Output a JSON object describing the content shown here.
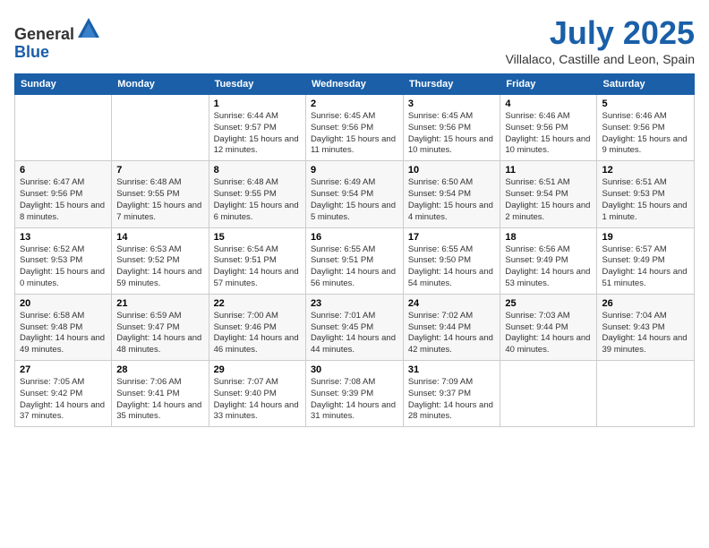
{
  "header": {
    "logo_general": "General",
    "logo_blue": "Blue",
    "month": "July 2025",
    "location": "Villalaco, Castille and Leon, Spain"
  },
  "weekdays": [
    "Sunday",
    "Monday",
    "Tuesday",
    "Wednesday",
    "Thursday",
    "Friday",
    "Saturday"
  ],
  "weeks": [
    [
      {
        "day": "",
        "info": ""
      },
      {
        "day": "",
        "info": ""
      },
      {
        "day": "1",
        "info": "Sunrise: 6:44 AM\nSunset: 9:57 PM\nDaylight: 15 hours and 12 minutes."
      },
      {
        "day": "2",
        "info": "Sunrise: 6:45 AM\nSunset: 9:56 PM\nDaylight: 15 hours and 11 minutes."
      },
      {
        "day": "3",
        "info": "Sunrise: 6:45 AM\nSunset: 9:56 PM\nDaylight: 15 hours and 10 minutes."
      },
      {
        "day": "4",
        "info": "Sunrise: 6:46 AM\nSunset: 9:56 PM\nDaylight: 15 hours and 10 minutes."
      },
      {
        "day": "5",
        "info": "Sunrise: 6:46 AM\nSunset: 9:56 PM\nDaylight: 15 hours and 9 minutes."
      }
    ],
    [
      {
        "day": "6",
        "info": "Sunrise: 6:47 AM\nSunset: 9:56 PM\nDaylight: 15 hours and 8 minutes."
      },
      {
        "day": "7",
        "info": "Sunrise: 6:48 AM\nSunset: 9:55 PM\nDaylight: 15 hours and 7 minutes."
      },
      {
        "day": "8",
        "info": "Sunrise: 6:48 AM\nSunset: 9:55 PM\nDaylight: 15 hours and 6 minutes."
      },
      {
        "day": "9",
        "info": "Sunrise: 6:49 AM\nSunset: 9:54 PM\nDaylight: 15 hours and 5 minutes."
      },
      {
        "day": "10",
        "info": "Sunrise: 6:50 AM\nSunset: 9:54 PM\nDaylight: 15 hours and 4 minutes."
      },
      {
        "day": "11",
        "info": "Sunrise: 6:51 AM\nSunset: 9:54 PM\nDaylight: 15 hours and 2 minutes."
      },
      {
        "day": "12",
        "info": "Sunrise: 6:51 AM\nSunset: 9:53 PM\nDaylight: 15 hours and 1 minute."
      }
    ],
    [
      {
        "day": "13",
        "info": "Sunrise: 6:52 AM\nSunset: 9:53 PM\nDaylight: 15 hours and 0 minutes."
      },
      {
        "day": "14",
        "info": "Sunrise: 6:53 AM\nSunset: 9:52 PM\nDaylight: 14 hours and 59 minutes."
      },
      {
        "day": "15",
        "info": "Sunrise: 6:54 AM\nSunset: 9:51 PM\nDaylight: 14 hours and 57 minutes."
      },
      {
        "day": "16",
        "info": "Sunrise: 6:55 AM\nSunset: 9:51 PM\nDaylight: 14 hours and 56 minutes."
      },
      {
        "day": "17",
        "info": "Sunrise: 6:55 AM\nSunset: 9:50 PM\nDaylight: 14 hours and 54 minutes."
      },
      {
        "day": "18",
        "info": "Sunrise: 6:56 AM\nSunset: 9:49 PM\nDaylight: 14 hours and 53 minutes."
      },
      {
        "day": "19",
        "info": "Sunrise: 6:57 AM\nSunset: 9:49 PM\nDaylight: 14 hours and 51 minutes."
      }
    ],
    [
      {
        "day": "20",
        "info": "Sunrise: 6:58 AM\nSunset: 9:48 PM\nDaylight: 14 hours and 49 minutes."
      },
      {
        "day": "21",
        "info": "Sunrise: 6:59 AM\nSunset: 9:47 PM\nDaylight: 14 hours and 48 minutes."
      },
      {
        "day": "22",
        "info": "Sunrise: 7:00 AM\nSunset: 9:46 PM\nDaylight: 14 hours and 46 minutes."
      },
      {
        "day": "23",
        "info": "Sunrise: 7:01 AM\nSunset: 9:45 PM\nDaylight: 14 hours and 44 minutes."
      },
      {
        "day": "24",
        "info": "Sunrise: 7:02 AM\nSunset: 9:44 PM\nDaylight: 14 hours and 42 minutes."
      },
      {
        "day": "25",
        "info": "Sunrise: 7:03 AM\nSunset: 9:44 PM\nDaylight: 14 hours and 40 minutes."
      },
      {
        "day": "26",
        "info": "Sunrise: 7:04 AM\nSunset: 9:43 PM\nDaylight: 14 hours and 39 minutes."
      }
    ],
    [
      {
        "day": "27",
        "info": "Sunrise: 7:05 AM\nSunset: 9:42 PM\nDaylight: 14 hours and 37 minutes."
      },
      {
        "day": "28",
        "info": "Sunrise: 7:06 AM\nSunset: 9:41 PM\nDaylight: 14 hours and 35 minutes."
      },
      {
        "day": "29",
        "info": "Sunrise: 7:07 AM\nSunset: 9:40 PM\nDaylight: 14 hours and 33 minutes."
      },
      {
        "day": "30",
        "info": "Sunrise: 7:08 AM\nSunset: 9:39 PM\nDaylight: 14 hours and 31 minutes."
      },
      {
        "day": "31",
        "info": "Sunrise: 7:09 AM\nSunset: 9:37 PM\nDaylight: 14 hours and 28 minutes."
      },
      {
        "day": "",
        "info": ""
      },
      {
        "day": "",
        "info": ""
      }
    ]
  ]
}
